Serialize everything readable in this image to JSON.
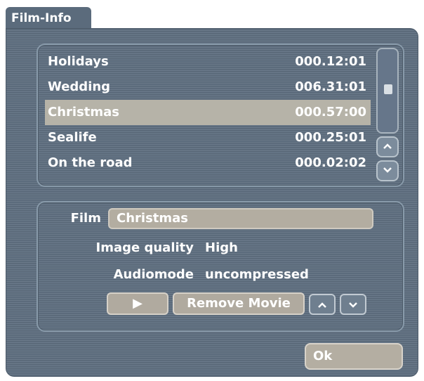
{
  "window": {
    "title": "Film-Info"
  },
  "film_list": {
    "items": [
      {
        "name": "Holidays",
        "duration": "000.12:01",
        "selected": false
      },
      {
        "name": "Wedding",
        "duration": "006.31:01",
        "selected": false
      },
      {
        "name": "Christmas",
        "duration": "000.57:00",
        "selected": true
      },
      {
        "name": "Sealife",
        "duration": "000.25:01",
        "selected": false
      },
      {
        "name": "On the road",
        "duration": "000.02:02",
        "selected": false
      }
    ]
  },
  "info": {
    "film_label": "Film",
    "film_value": "Christmas",
    "image_quality_label": "Image quality",
    "image_quality_value": "High",
    "audiomode_label": "Audiomode",
    "audiomode_value": "uncompressed"
  },
  "buttons": {
    "play": "▶",
    "remove_movie": "Remove Movie",
    "ok": "Ok"
  },
  "icons": {
    "scroll_up": "chevron-up-icon",
    "scroll_down": "chevron-down-icon",
    "move_up": "chevron-up-icon",
    "move_down": "chevron-down-icon"
  }
}
